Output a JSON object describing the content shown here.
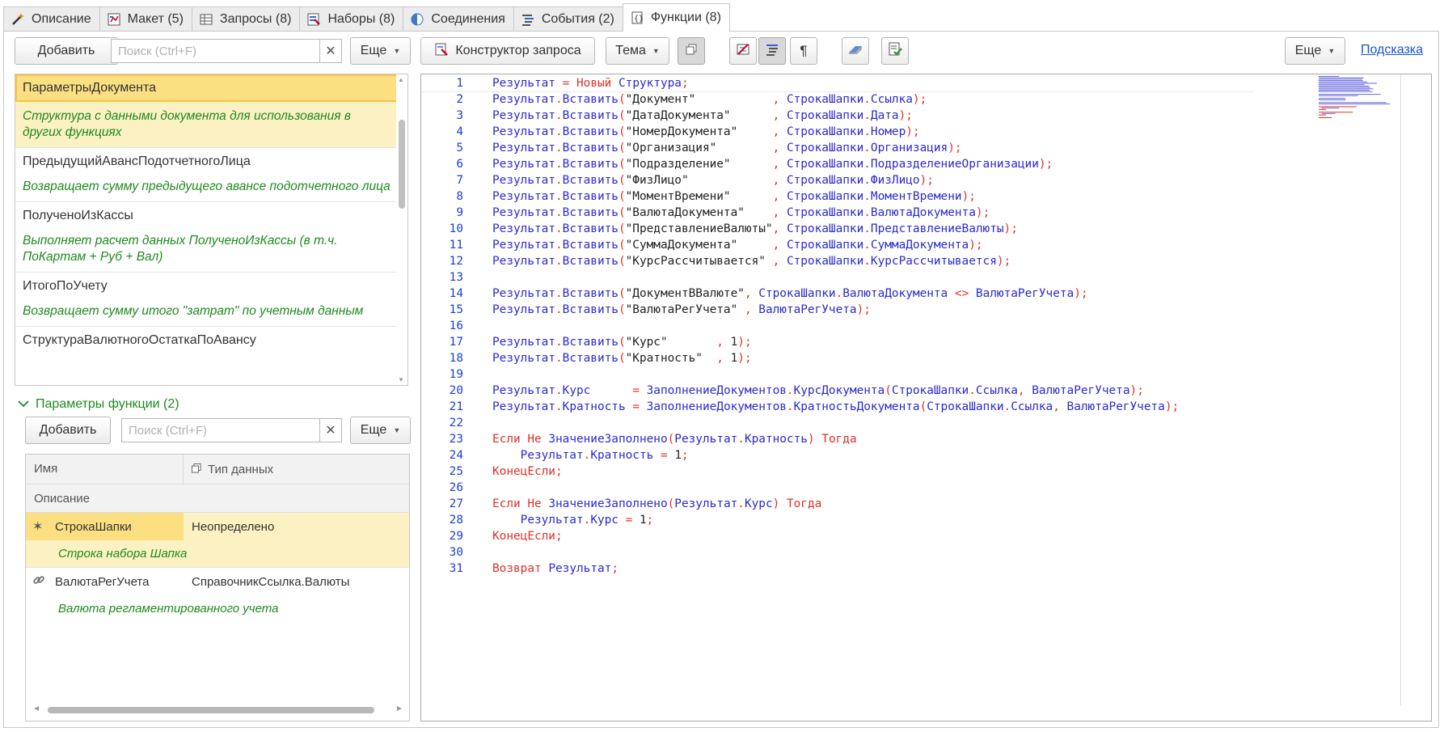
{
  "tabs": [
    {
      "label": "Описание",
      "icon": "wand-icon"
    },
    {
      "label": "Макет (5)",
      "icon": "layout-icon"
    },
    {
      "label": "Запросы (8)",
      "icon": "table-icon"
    },
    {
      "label": "Наборы (8)",
      "icon": "datasets-icon"
    },
    {
      "label": "Соединения",
      "icon": "circle-half-icon"
    },
    {
      "label": "События (2)",
      "icon": "events-icon"
    },
    {
      "label": "Функции (8)",
      "icon": "function-icon"
    }
  ],
  "left_toolbar": {
    "add": "Добавить",
    "search_placeholder": "Поиск (Ctrl+F)",
    "more": "Еще"
  },
  "functions": [
    {
      "name": "ПараметрыДокумента",
      "desc": "Структура с данными документа для использования в других функциях"
    },
    {
      "name": "ПредыдущийАвансПодотчетногоЛица",
      "desc": "Возвращает сумму предыдущего авансе подотчетного лица"
    },
    {
      "name": "ПолученоИзКассы",
      "desc": "Выполняет расчет данных ПолученоИзКассы (в т.ч. ПоКартам + Руб + Вал)"
    },
    {
      "name": "ИтогоПоУчету",
      "desc": "Возвращает сумму итого \"затрат\" по учетным данным"
    },
    {
      "name": "СтруктураВалютногоОстаткаПоАвансу",
      "desc": ""
    }
  ],
  "params": {
    "header": "Параметры функции (2)",
    "add": "Добавить",
    "search_placeholder": "Поиск (Ctrl+F)",
    "more": "Еще",
    "col_name": "Имя",
    "col_type": "Тип данных",
    "col_desc": "Описание",
    "rows": [
      {
        "name": "СтрокаШапки",
        "type": "Неопределено",
        "desc": "Строка набора Шапка",
        "icon": "star-icon"
      },
      {
        "name": "ВалютаРегУчета",
        "type": "СправочникСсылка.Валюты",
        "desc": "Валюта регламентированного учета",
        "icon": "link-icon"
      }
    ]
  },
  "right_toolbar": {
    "constructor": "Конструктор запроса",
    "theme": "Тема",
    "more": "Еще",
    "help": "Подсказка"
  },
  "code_lines": [
    "Результат = Новый Структура;",
    "Результат.Вставить(\"Документ\"           , СтрокаШапки.Ссылка);",
    "Результат.Вставить(\"ДатаДокумента\"      , СтрокаШапки.Дата);",
    "Результат.Вставить(\"НомерДокумента\"     , СтрокаШапки.Номер);",
    "Результат.Вставить(\"Организация\"        , СтрокаШапки.Организация);",
    "Результат.Вставить(\"Подразделение\"      , СтрокаШапки.ПодразделениеОрганизации);",
    "Результат.Вставить(\"ФизЛицо\"            , СтрокаШапки.ФизЛицо);",
    "Результат.Вставить(\"МоментВремени\"      , СтрокаШапки.МоментВремени);",
    "Результат.Вставить(\"ВалютаДокумента\"    , СтрокаШапки.ВалютаДокумента);",
    "Результат.Вставить(\"ПредставлениеВалюты\", СтрокаШапки.ПредставлениеВалюты);",
    "Результат.Вставить(\"СуммаДокумента\"     , СтрокаШапки.СуммаДокумента);",
    "Результат.Вставить(\"КурсРассчитывается\" , СтрокаШапки.КурсРассчитывается);",
    "",
    "Результат.Вставить(\"ДокументВВалюте\", СтрокаШапки.ВалютаДокумента <> ВалютаРегУчета);",
    "Результат.Вставить(\"ВалютаРегУчета\" , ВалютаРегУчета);",
    "",
    "Результат.Вставить(\"Курс\"       , 1);",
    "Результат.Вставить(\"Кратность\"  , 1);",
    "",
    "Результат.Курс      = ЗаполнениеДокументов.КурсДокумента(СтрокаШапки.Ссылка, ВалютаРегУчета);",
    "Результат.Кратность = ЗаполнениеДокументов.КратностьДокумента(СтрокаШапки.Ссылка, ВалютаРегУчета);",
    "",
    "Если Не ЗначениеЗаполнено(Результат.Кратность) Тогда",
    "    Результат.Кратность = 1;",
    "КонецЕсли;",
    "",
    "Если Не ЗначениеЗаполнено(Результат.Курс) Тогда",
    "    Результат.Курс = 1;",
    "КонецЕсли;",
    "",
    "Возврат Результат;"
  ],
  "colors": {
    "keyword": "#e0302a",
    "identifier": "#2a2ad0",
    "string": "#222222",
    "comment_green": "#1e8a1e",
    "selection": "#fcf1c2",
    "link": "#1a55c8"
  }
}
